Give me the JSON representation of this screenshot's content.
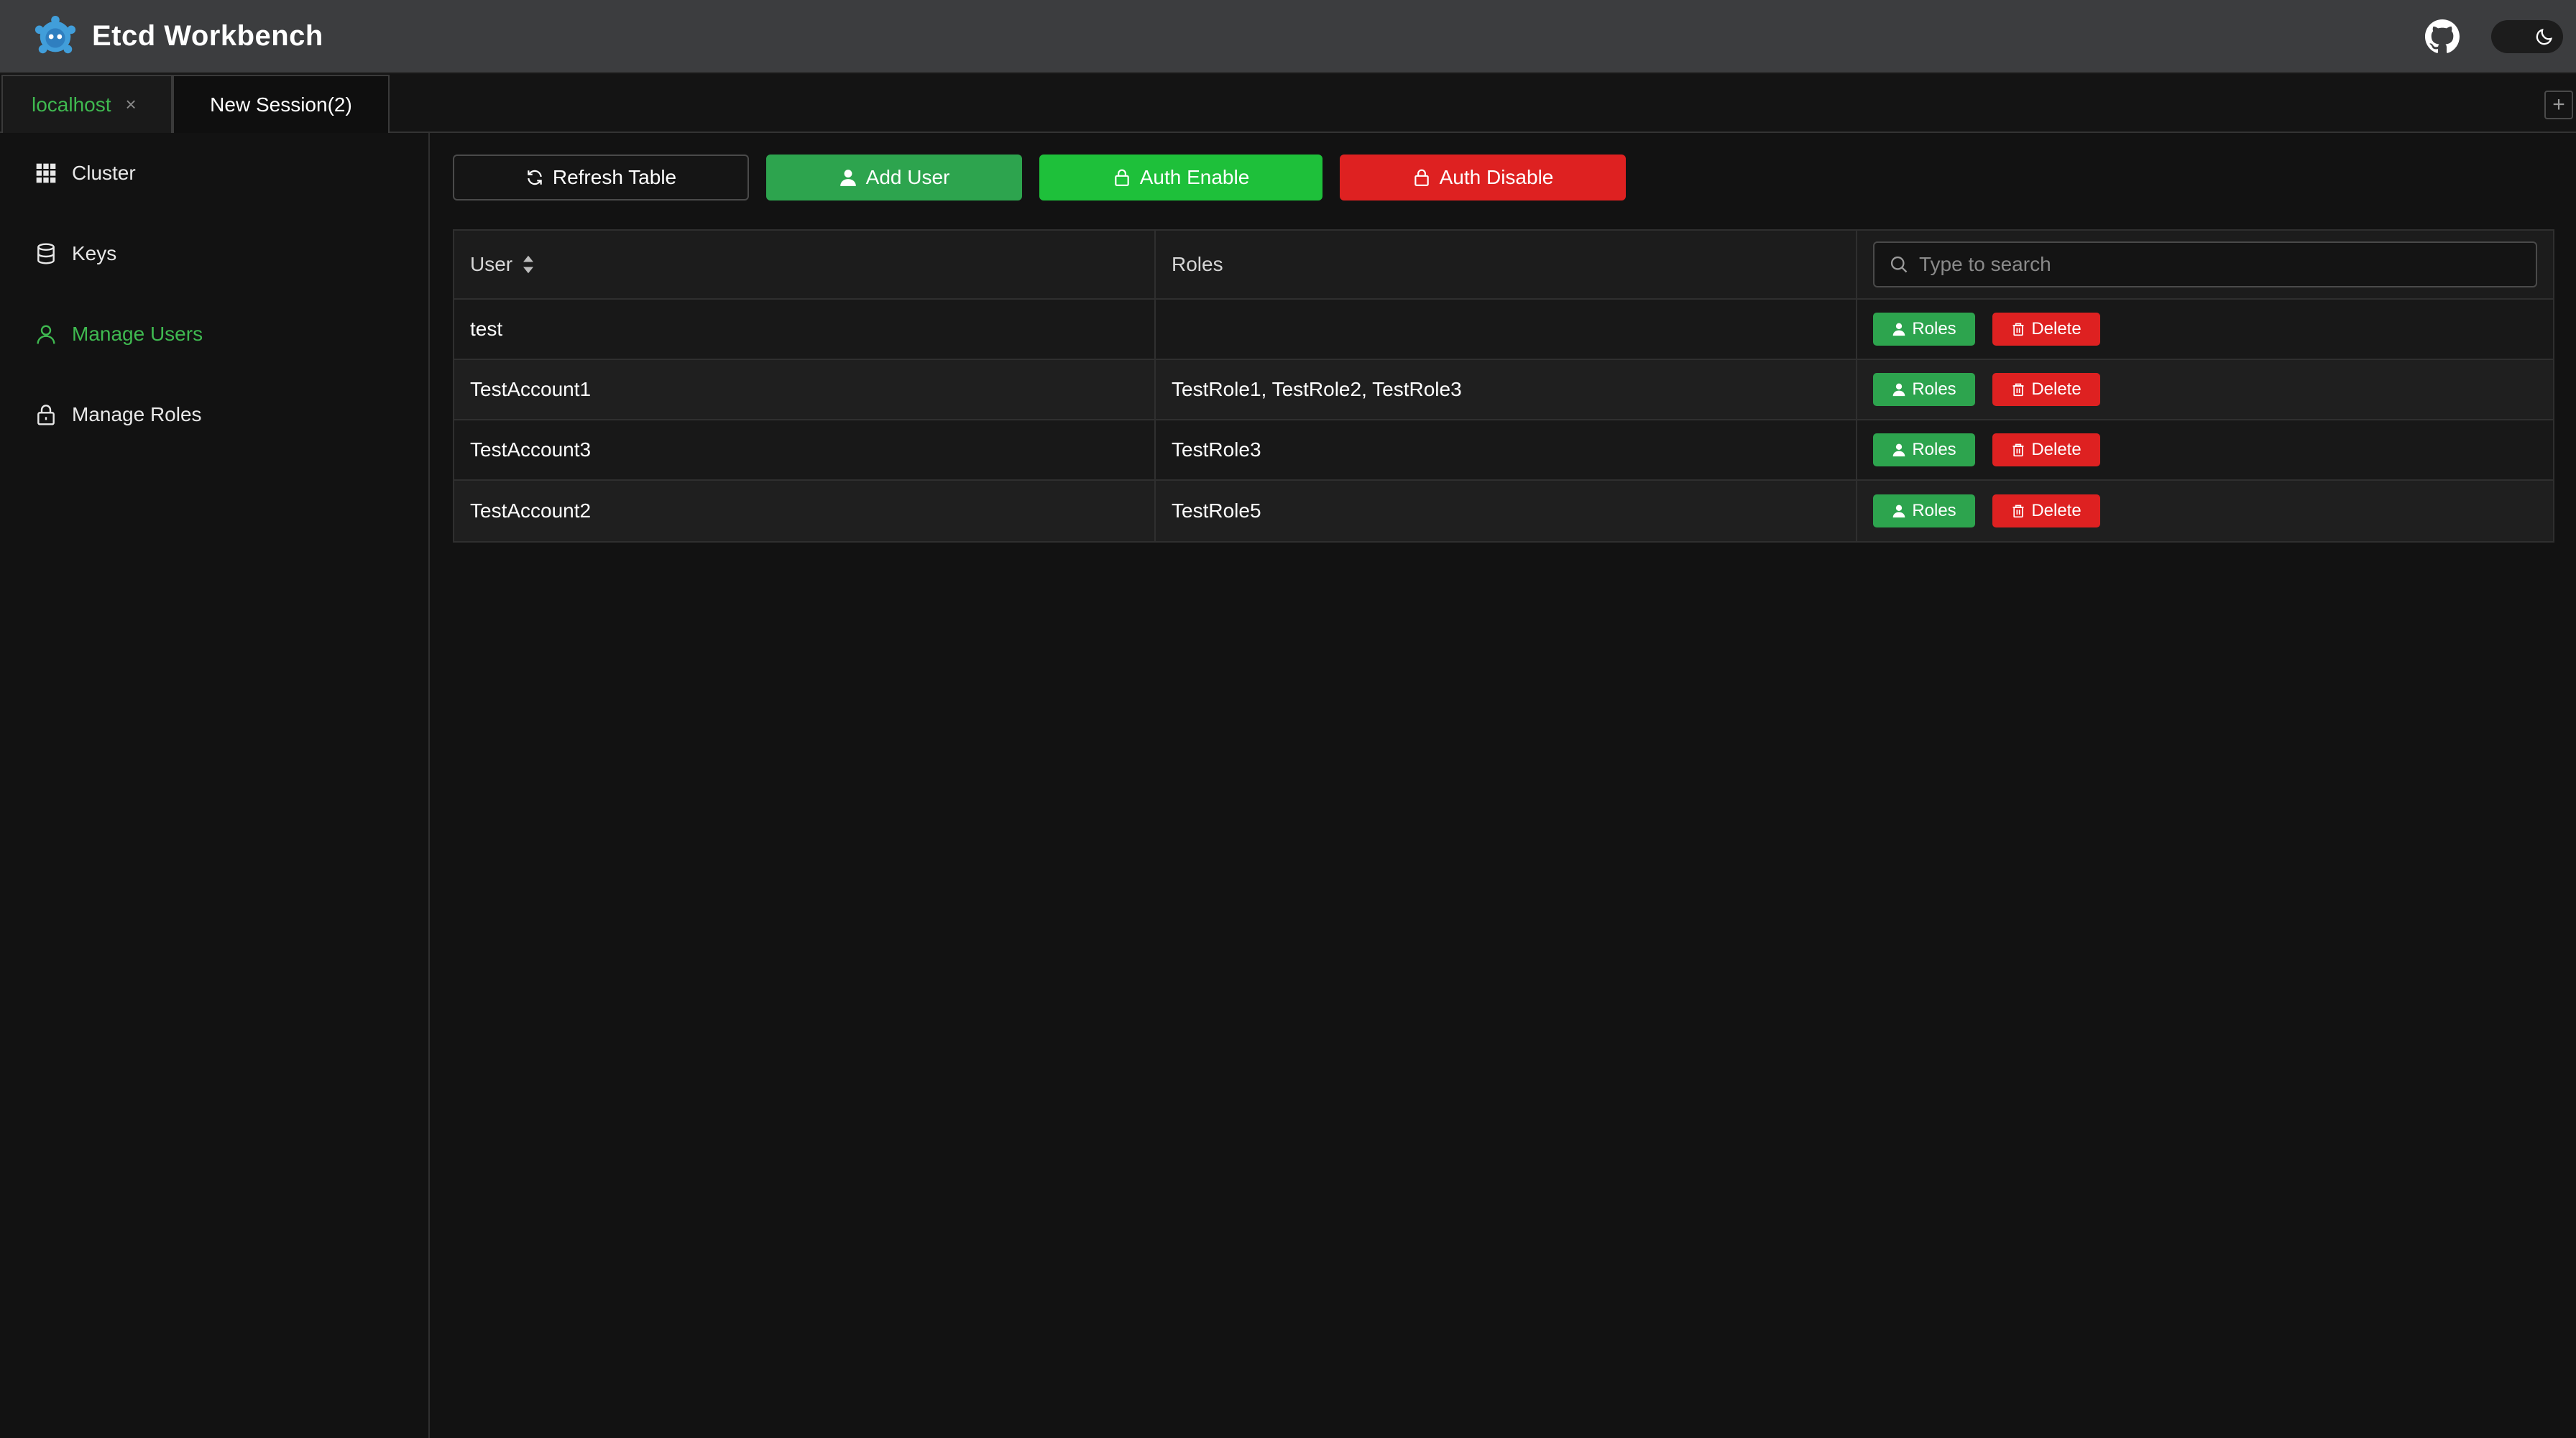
{
  "app": {
    "title": "Etcd Workbench"
  },
  "tabs": [
    {
      "label": "localhost",
      "active": true,
      "close": "×"
    },
    {
      "label": "New Session(2)",
      "active": false
    }
  ],
  "tab_add": "+",
  "sidebar": {
    "items": [
      {
        "label": "Cluster",
        "icon": "grid-icon"
      },
      {
        "label": "Keys",
        "icon": "database-icon"
      },
      {
        "label": "Manage Users",
        "icon": "user-icon",
        "active": true
      },
      {
        "label": "Manage Roles",
        "icon": "lock-icon"
      }
    ]
  },
  "toolbar": {
    "refresh_label": "Refresh Table",
    "add_user_label": "Add User",
    "auth_enable_label": "Auth Enable",
    "auth_disable_label": "Auth Disable"
  },
  "table": {
    "headers": {
      "user": "User",
      "roles": "Roles"
    },
    "search_placeholder": "Type to search",
    "actions": {
      "roles": "Roles",
      "delete": "Delete"
    },
    "rows": [
      {
        "user": "test",
        "roles": ""
      },
      {
        "user": "TestAccount1",
        "roles": "TestRole1, TestRole2, TestRole3"
      },
      {
        "user": "TestAccount3",
        "roles": "TestRole3"
      },
      {
        "user": "TestAccount2",
        "roles": "TestRole5"
      }
    ]
  },
  "colors": {
    "accent_green": "#3fb950",
    "button_green": "#2da44e",
    "enable_green": "#1ec03a",
    "danger_red": "#de2121",
    "background": "#121212",
    "titlebar": "#3c3d3f"
  }
}
